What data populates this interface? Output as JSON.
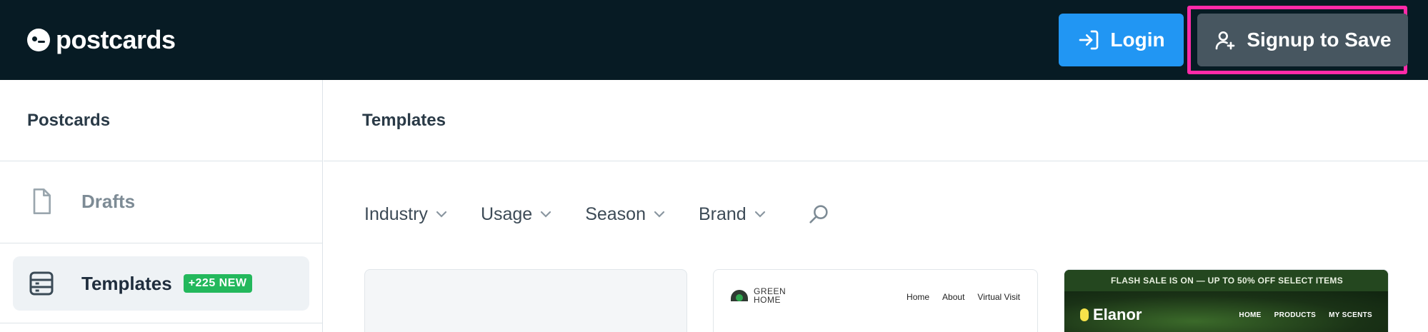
{
  "header": {
    "logo_text": "postcards",
    "login_label": "Login",
    "signup_label": "Signup to Save"
  },
  "sidebar": {
    "title": "Postcards",
    "items": [
      {
        "label": "Drafts",
        "icon": "document-icon"
      },
      {
        "label": "Templates",
        "icon": "templates-icon",
        "badge": "+225 NEW"
      }
    ]
  },
  "main": {
    "title": "Templates",
    "filters": [
      "Industry",
      "Usage",
      "Season",
      "Brand"
    ]
  },
  "cards": {
    "green_home": {
      "logo_line1": "GREEN",
      "logo_line2": "HOME",
      "nav": [
        "Home",
        "About",
        "Virtual Visit"
      ]
    },
    "elanor": {
      "banner": "FLASH SALE IS ON — UP TO 50% OFF SELECT ITEMS",
      "logo": "Elanor",
      "nav": [
        "HOME",
        "PRODUCTS",
        "MY SCENTS"
      ]
    }
  },
  "colors": {
    "topbar": "#071b24",
    "login": "#2196f3",
    "signup": "#475660",
    "highlight": "#ff2aa8",
    "badge": "#23b85c"
  }
}
